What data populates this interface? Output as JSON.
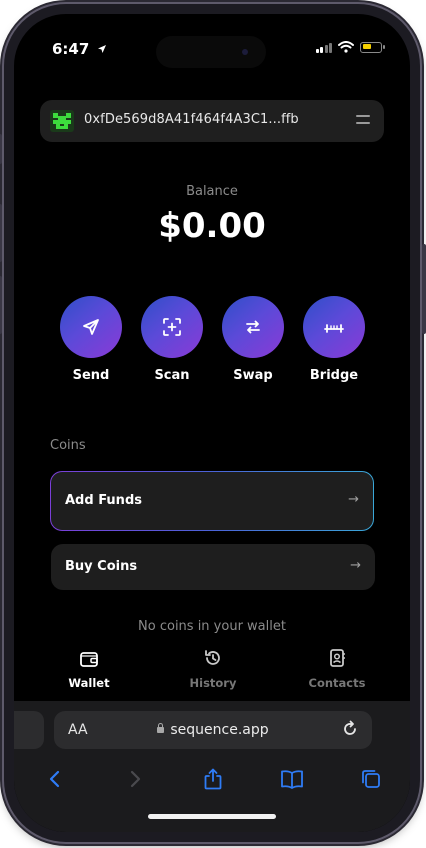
{
  "status": {
    "time": "6:47"
  },
  "wallet": {
    "address": "0xfDe569d8A41f464f4A3C1...ffb",
    "balance_label": "Balance",
    "balance": "$0.00"
  },
  "actions": [
    {
      "label": "Send",
      "icon": "send-icon"
    },
    {
      "label": "Scan",
      "icon": "scan-icon"
    },
    {
      "label": "Swap",
      "icon": "swap-icon"
    },
    {
      "label": "Bridge",
      "icon": "bridge-icon"
    }
  ],
  "coins": {
    "section_label": "Coins",
    "add_funds_label": "Add Funds",
    "buy_coins_label": "Buy Coins",
    "arrow": "→",
    "empty_text": "No coins in your wallet"
  },
  "tabs": [
    {
      "label": "Wallet",
      "icon": "wallet-icon",
      "active": true
    },
    {
      "label": "History",
      "icon": "history-icon",
      "active": false
    },
    {
      "label": "Contacts",
      "icon": "contacts-icon",
      "active": false
    }
  ],
  "browser": {
    "text_size_label": "AA",
    "url": "sequence.app"
  },
  "colors": {
    "accent_gradient_start": "#2e4fc8",
    "accent_gradient_end": "#8a3ad6",
    "browser_blue": "#2f7cf6",
    "logo_green": "#3ddc3d"
  }
}
